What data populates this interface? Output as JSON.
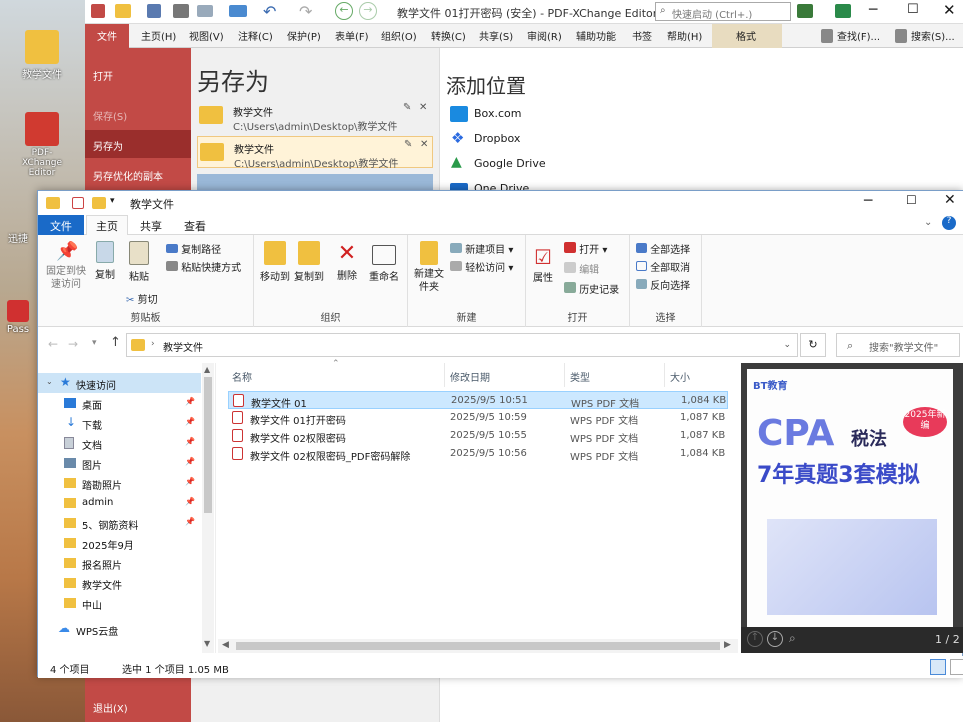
{
  "desktop": {
    "icons": [
      {
        "label": "教学文件",
        "color": "#f0c040"
      },
      {
        "label": "PDF-XChange Editor",
        "color": "#d03a30"
      },
      {
        "label": "迅捷",
        "color": "#3070d0"
      },
      {
        "label": "Pass",
        "color": "#d03030"
      }
    ]
  },
  "pdfx": {
    "title": "教学文件 01打开密码 (安全) - PDF-XChange Editor",
    "search_placeholder": "快速启动 (Ctrl+.)",
    "tabs": [
      "文件",
      "主页(H)",
      "视图(V)",
      "注释(C)",
      "保护(P)",
      "表单(F)",
      "组织(O)",
      "转换(C)",
      "共享(S)",
      "审阅(R)",
      "辅助功能",
      "书签",
      "帮助(H)",
      "格式"
    ],
    "find_label": "查找(F)...",
    "search_label": "搜索(S)...",
    "side": [
      "打开",
      "保存(S)",
      "另存为",
      "另存优化的副本",
      "退出(X)"
    ],
    "saveas_title": "另存为",
    "recent": [
      {
        "name": "教学文件",
        "path": "C:\\Users\\admin\\Desktop\\教学文件"
      },
      {
        "name": "教学文件",
        "path": "C:\\Users\\admin\\Desktop\\教学文件"
      }
    ],
    "add_location_title": "添加位置",
    "locations": [
      "Box.com",
      "Dropbox",
      "Google Drive",
      "One Drive"
    ]
  },
  "explorer": {
    "title": "教学文件",
    "ribbon_tabs": [
      "文件",
      "主页",
      "共享",
      "查看"
    ],
    "groups": {
      "clipboard": {
        "label": "剪贴板",
        "pin": "固定到快速访问",
        "copy": "复制",
        "paste": "粘贴",
        "copy_path": "复制路径",
        "paste_shortcut": "粘贴快捷方式",
        "cut": "剪切"
      },
      "organize": {
        "label": "组织",
        "move": "移动到",
        "copyto": "复制到",
        "delete": "删除",
        "rename": "重命名"
      },
      "new": {
        "label": "新建",
        "folder": "新建文件夹",
        "item": "新建项目",
        "easy": "轻松访问"
      },
      "open": {
        "label": "打开",
        "props": "属性",
        "open": "打开",
        "edit": "编辑",
        "history": "历史记录"
      },
      "select": {
        "label": "选择",
        "all": "全部选择",
        "none": "全部取消",
        "invert": "反向选择"
      }
    },
    "address": "教学文件",
    "search_placeholder": "搜索\"教学文件\"",
    "nav": [
      {
        "label": "快速访问",
        "pin": false,
        "color": "#2a7ad8"
      },
      {
        "label": "桌面",
        "pin": true,
        "color": "#2a7ad8"
      },
      {
        "label": "下载",
        "pin": true,
        "color": "#2a7ad8"
      },
      {
        "label": "文档",
        "pin": true,
        "color": "#8a9aaa"
      },
      {
        "label": "图片",
        "pin": true,
        "color": "#6a8aaa"
      },
      {
        "label": "踏勘照片",
        "pin": true,
        "color": "#f0c040"
      },
      {
        "label": "admin",
        "pin": true,
        "color": "#f0c040"
      },
      {
        "label": "5、钢筋资料",
        "pin": true,
        "color": "#f0c040"
      },
      {
        "label": "2025年9月",
        "pin": false,
        "color": "#f0c040"
      },
      {
        "label": "报名照片",
        "pin": false,
        "color": "#f0c040"
      },
      {
        "label": "教学文件",
        "pin": false,
        "color": "#f0c040"
      },
      {
        "label": "中山",
        "pin": false,
        "color": "#f0c040"
      },
      {
        "label": "WPS云盘",
        "pin": false,
        "color": "#3a8ae8"
      }
    ],
    "columns": [
      "名称",
      "修改日期",
      "类型",
      "大小"
    ],
    "files": [
      {
        "name": "教学文件 01",
        "date": "2025/9/5 10:51",
        "type": "WPS PDF 文档",
        "size": "1,084 KB",
        "selected": true
      },
      {
        "name": "教学文件 01打开密码",
        "date": "2025/9/5 10:59",
        "type": "WPS PDF 文档",
        "size": "1,087 KB",
        "selected": false
      },
      {
        "name": "教学文件 02权限密码",
        "date": "2025/9/5 10:55",
        "type": "WPS PDF 文档",
        "size": "1,087 KB",
        "selected": false
      },
      {
        "name": "教学文件 02权限密码_PDF密码解除",
        "date": "2025/9/5 10:56",
        "type": "WPS PDF 文档",
        "size": "1,084 KB",
        "selected": false
      }
    ],
    "preview": {
      "brand": "BT教育",
      "main": "CPA",
      "sub": "税法",
      "line": "7年真题3套模拟",
      "badge": "2025年新编",
      "page": "1 / 2"
    },
    "status": {
      "count": "4 个项目",
      "selected": "选中 1 个项目  1.05 MB"
    }
  }
}
